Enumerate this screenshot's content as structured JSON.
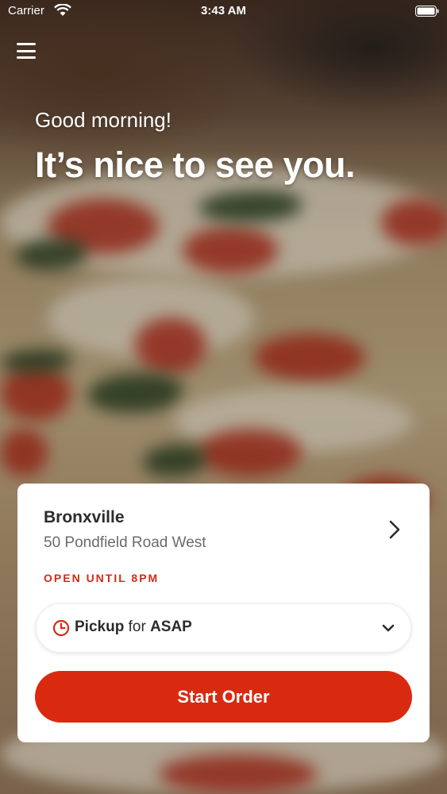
{
  "status_bar": {
    "carrier": "Carrier",
    "time": "3:43 AM",
    "wifi_icon": "wifi-icon",
    "battery_icon": "battery-icon"
  },
  "header": {
    "menu_icon": "hamburger-menu-icon",
    "greeting": "Good morning!",
    "headline": "It’s nice to see you."
  },
  "location": {
    "name": "Bronxville",
    "address": "50 Pondfield Road West",
    "status": "OPEN UNTIL 8PM",
    "chevron_icon": "chevron-right-icon"
  },
  "order_mode": {
    "icon": "clock-icon",
    "mode": "Pickup",
    "connector": "for",
    "time": "ASAP",
    "caret_icon": "chevron-down-icon"
  },
  "cta": {
    "label": "Start Order"
  },
  "colors": {
    "accent": "#d92a10",
    "status_red": "#d42a18",
    "text_dark": "#2b2b2b",
    "text_muted": "#6b6b6b"
  }
}
